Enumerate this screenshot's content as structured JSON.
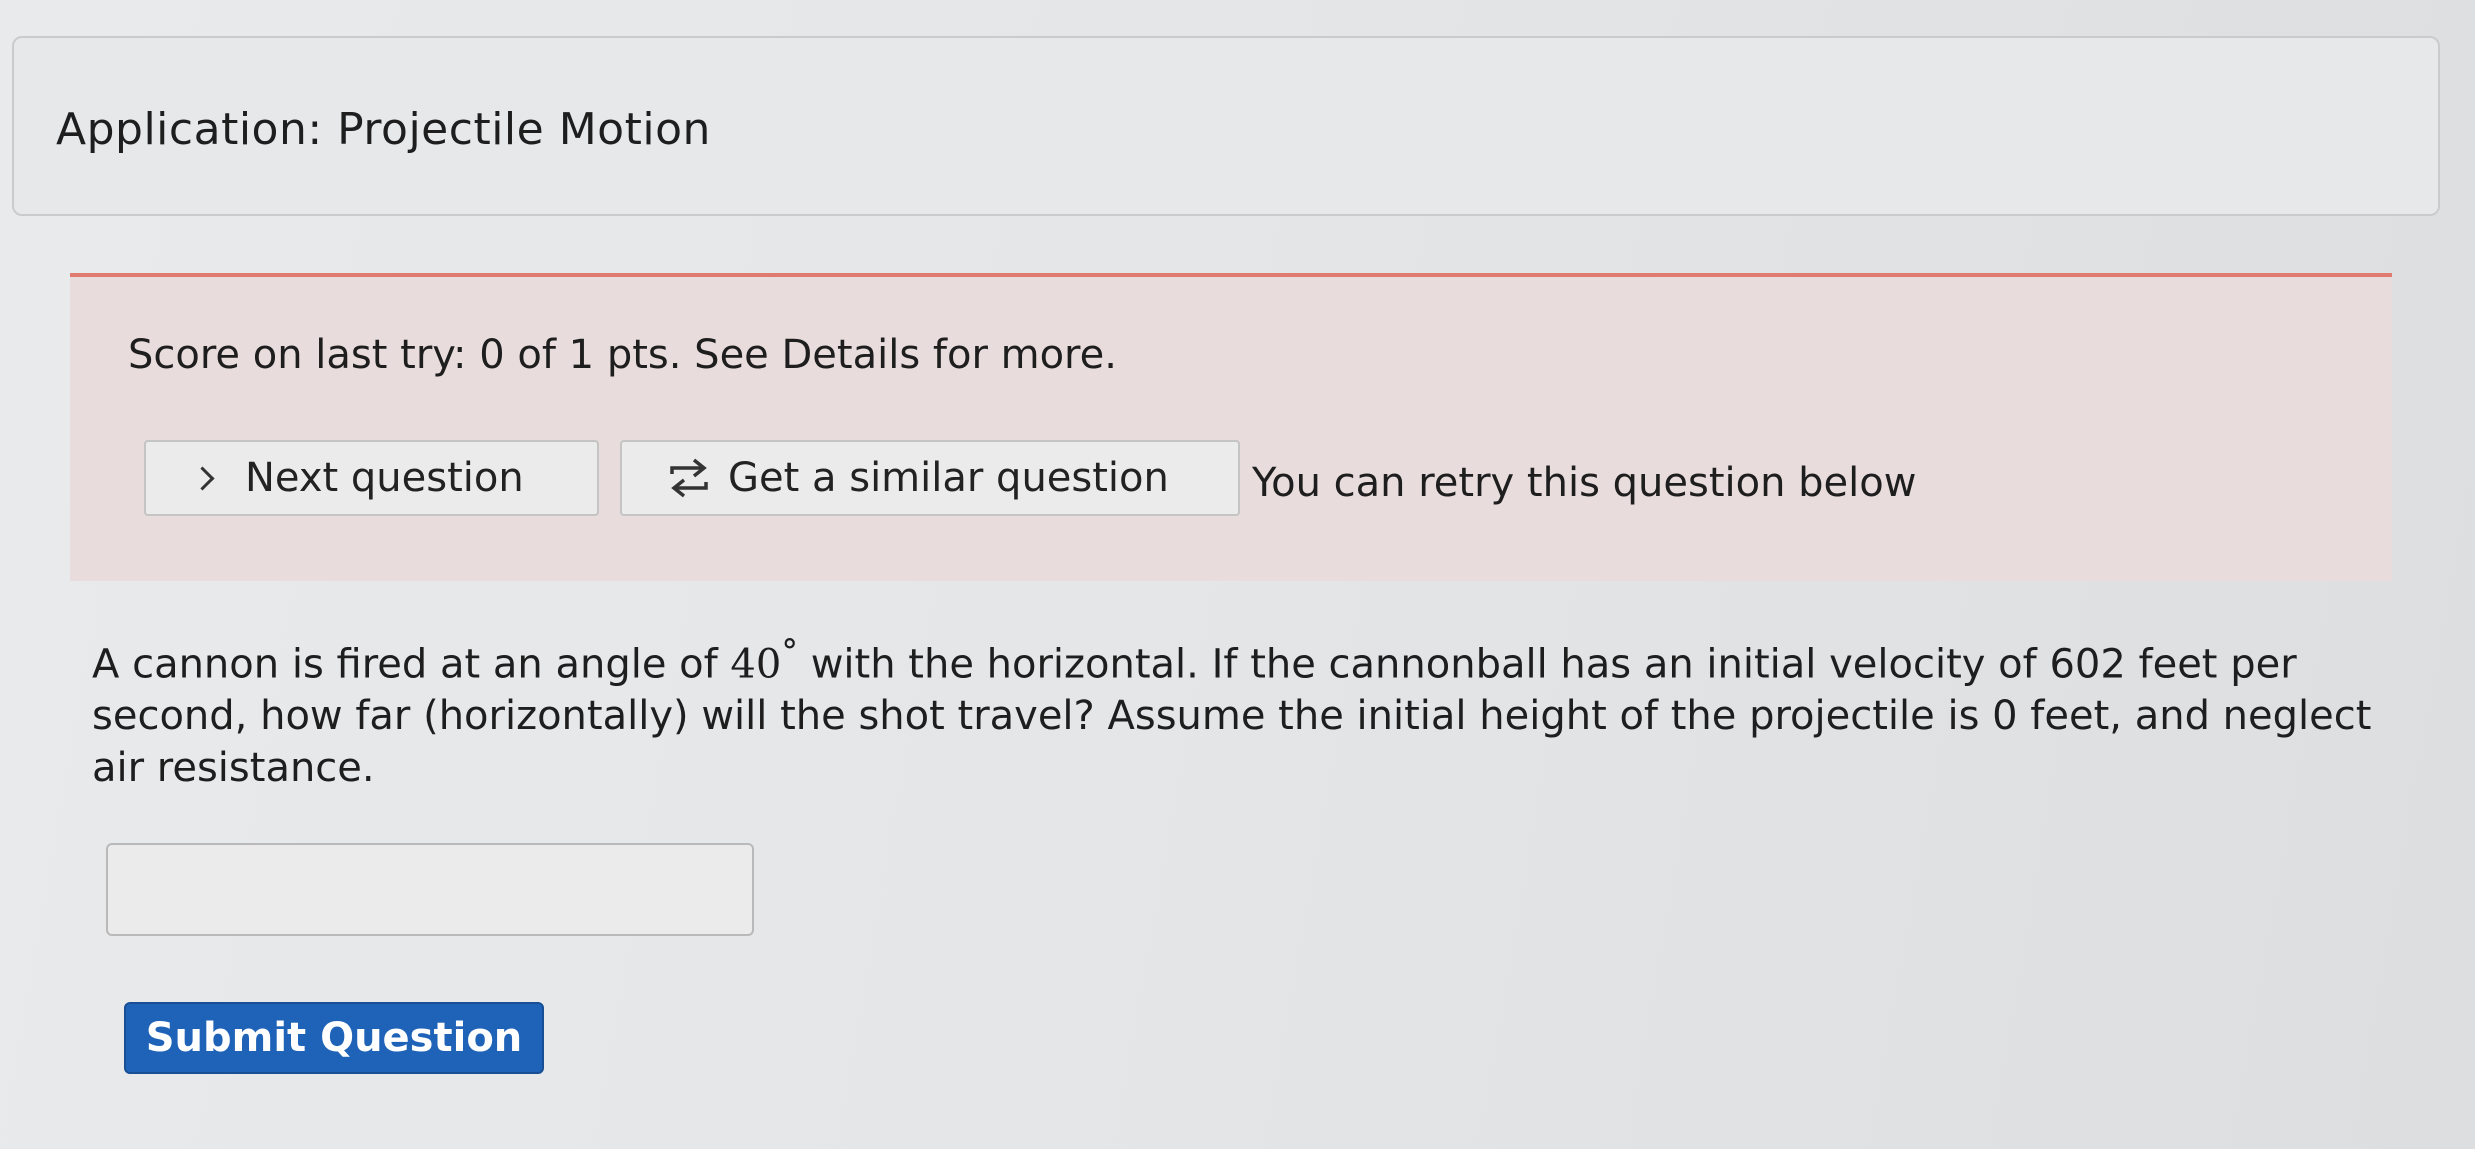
{
  "header": {
    "title": "Application: Projectile Motion"
  },
  "feedback": {
    "score_text": "Score on last try: 0 of 1 pts. See Details for more.",
    "next_button": "Next question",
    "similar_button": "Get a similar question",
    "retry_text": "You can retry this question below"
  },
  "question": {
    "text_before": "A cannon is fired at an angle of ",
    "angle": "40",
    "degree_symbol": "°",
    "text_after": " with the horizontal. If the cannonball has an initial velocity of 602 feet per second, how far (horizontally) will the shot travel? Assume the initial height of the projectile is 0 feet, and neglect air resistance."
  },
  "answer": {
    "value": ""
  },
  "submit": {
    "label": "Submit Question"
  },
  "icons": {
    "next": "chevron-right-icon",
    "similar": "retry-arrows-icon"
  },
  "colors": {
    "feedback_border": "#e07b72",
    "feedback_bg": "#e8dcdc",
    "submit_bg": "#1f63b8"
  }
}
